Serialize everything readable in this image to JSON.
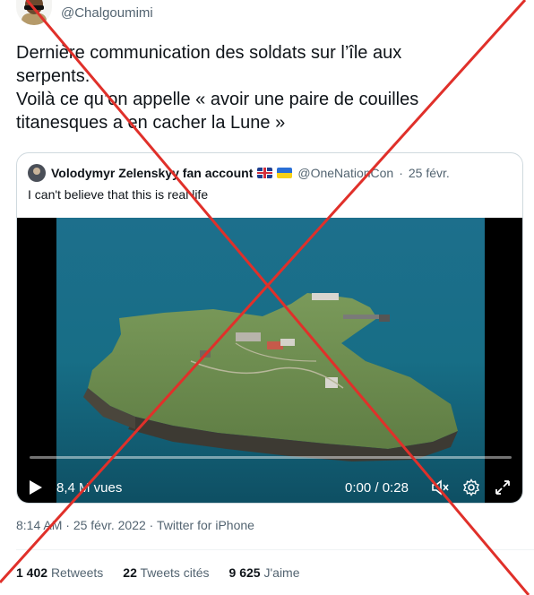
{
  "author": {
    "handle": "@Chalgoumimi",
    "avatar_icon": "avatar-portrait"
  },
  "tweet": {
    "lines": [
      "Dernière communication des soldats sur l’île aux",
      "serpents.",
      "Voilà ce qu’on appelle « avoir une paire de couilles",
      "titanesques a en cacher la Lune »"
    ]
  },
  "quoted": {
    "name": "Volodymyr Zelenskyy fan account",
    "flags": [
      "uk-flag",
      "ukraine-flag"
    ],
    "handle": "@OneNationCon",
    "separator": "·",
    "date": "25 févr.",
    "text": "I can't believe that this is real life",
    "video": {
      "views": "8,4 M vues",
      "current_time": "0:00",
      "time_separator": "/",
      "duration": "0:28",
      "progress": 0
    }
  },
  "meta": {
    "time": "8:14 AM",
    "date": "25 févr. 2022",
    "source": "Twitter for iPhone",
    "separator": "·"
  },
  "stats": [
    {
      "count": "1 402",
      "label": "Retweets"
    },
    {
      "count": "22",
      "label": "Tweets cités"
    },
    {
      "count": "9 625",
      "label": "J'aime"
    }
  ],
  "colors": {
    "text": "#0f1419",
    "muted": "#536471",
    "border": "#cfd9de",
    "cross": "#e0302a"
  }
}
